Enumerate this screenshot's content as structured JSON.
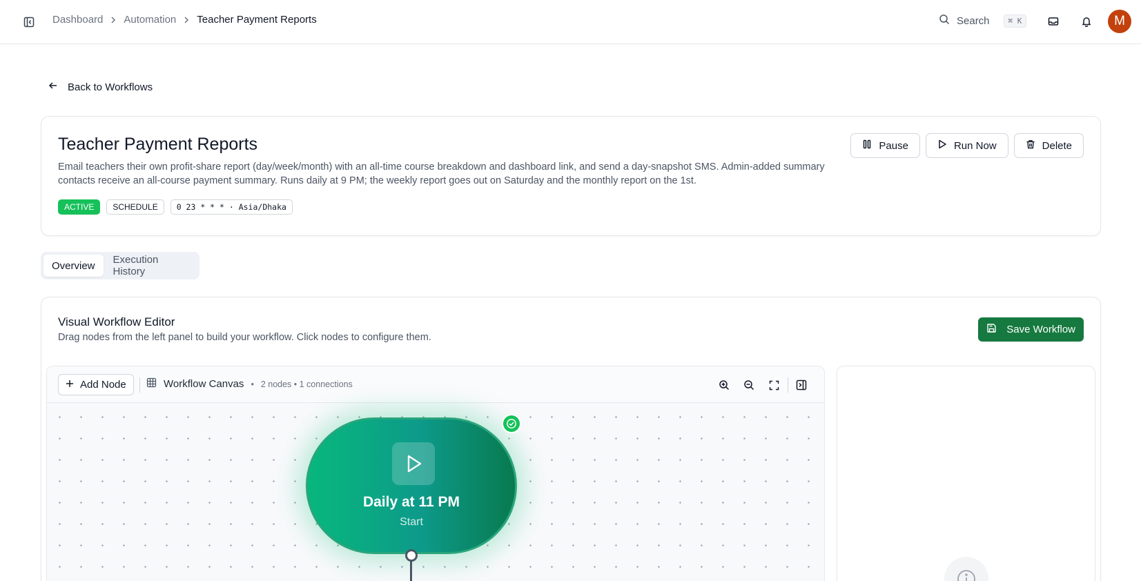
{
  "breadcrumb": {
    "items": [
      "Dashboard",
      "Automation"
    ],
    "current": "Teacher Payment Reports"
  },
  "topbar": {
    "search_label": "Search",
    "search_shortcut": "⌘ K",
    "avatar_initial": "M"
  },
  "back_link": "Back to Workflows",
  "workflow": {
    "title": "Teacher Payment Reports",
    "description": "Email teachers their own profit-share report (day/week/month) with an all-time course breakdown and dashboard link, and send a day-snapshot SMS. Admin-added summary contacts receive an all-course payment summary. Runs daily at 9 PM; the weekly report goes out on Saturday and the monthly report on the 1st.",
    "status": "ACTIVE",
    "trigger_type": "SCHEDULE",
    "cron": "0 23 * * * · Asia/Dhaka",
    "actions": {
      "pause": "Pause",
      "run_now": "Run Now",
      "delete": "Delete"
    }
  },
  "tabs": [
    "Overview",
    "Execution History"
  ],
  "editor": {
    "title": "Visual Workflow Editor",
    "subtitle": "Drag nodes from the left panel to build your workflow. Click nodes to configure them.",
    "save_label": "Save Workflow",
    "add_node_label": "Add Node",
    "canvas_label": "Workflow Canvas",
    "canvas_meta": "2 nodes • 1 connections"
  },
  "node": {
    "title": "Daily at 11 PM",
    "subtitle": "Start",
    "icon": "play-icon"
  },
  "colors": {
    "active_badge": "#16c15a",
    "save_button": "#16793f",
    "avatar": "#c2410c",
    "node_gradient_start": "#08b77c",
    "node_gradient_end": "#087a4f"
  }
}
